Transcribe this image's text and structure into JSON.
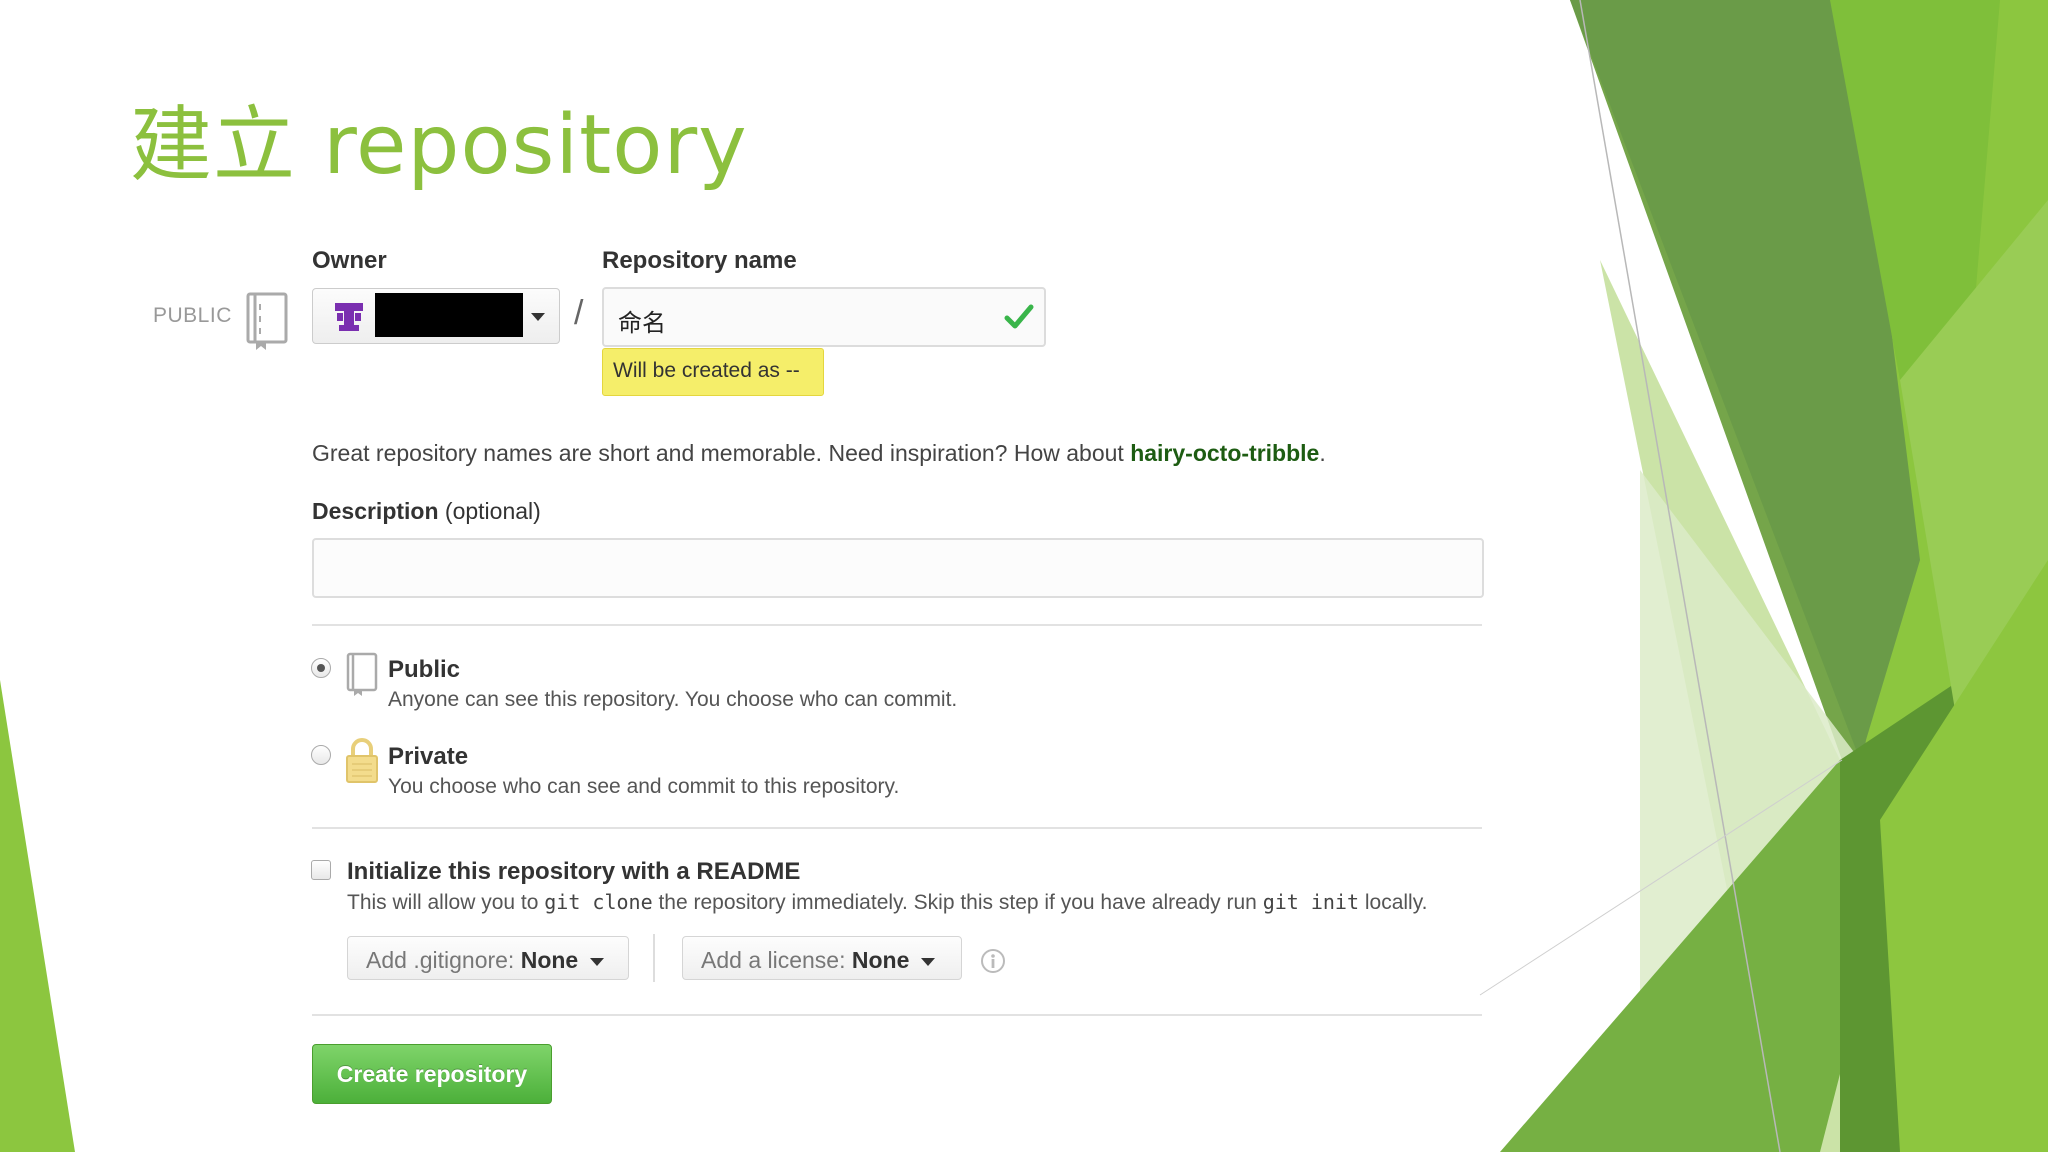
{
  "slide": {
    "title": "建立 repository"
  },
  "form": {
    "visibility_tag": "PUBLIC",
    "owner_label": "Owner",
    "repo_name_label": "Repository name",
    "slash": "/",
    "repo_name_value": "命名",
    "will_be_created": "Will be created as --",
    "hint_text": "Great repository names are short and memorable. Need inspiration? How about ",
    "hint_suggestion": "hairy-octo-tribble",
    "hint_end": ".",
    "description_label": "Description",
    "description_optional": "(optional)",
    "description_value": "",
    "public_title": "Public",
    "public_desc": "Anyone can see this repository. You choose who can commit.",
    "private_title": "Private",
    "private_desc": "You choose who can see and commit to this repository.",
    "init_title": "Initialize this repository with a README",
    "init_desc_1": "This will allow you to ",
    "init_code_1": "git clone",
    "init_desc_2": " the repository immediately. Skip this step if you have already run ",
    "init_code_2": "git init",
    "init_desc_3": " locally.",
    "gitignore_label": "Add .gitignore:",
    "gitignore_value": "None",
    "license_label": "Add a license:",
    "license_value": "None",
    "create_button": "Create repository",
    "visibility_selected": "Public",
    "init_readme_checked": false
  },
  "colors": {
    "title_green": "#8cc03e",
    "button_green": "#4cb03a",
    "tooltip_yellow": "#f5ee6a",
    "check_green": "#39b54a"
  },
  "icons": [
    "repo-book-icon",
    "owner-avatar-icon",
    "check-icon",
    "lock-icon",
    "info-icon",
    "caret-down-icon"
  ]
}
